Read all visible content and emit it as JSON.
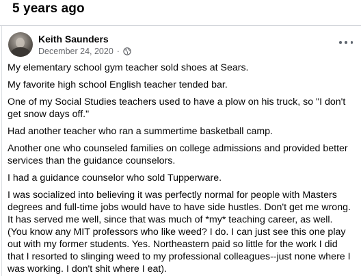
{
  "memory": {
    "title": "5 years ago"
  },
  "post": {
    "author": "Keith Saunders",
    "date": "December 24, 2020",
    "separator": "·",
    "privacy_icon": "globe-icon",
    "more_icon": "more-options-icon",
    "paragraphs": [
      "My elementary school gym teacher sold shoes at Sears.",
      "My favorite high school English teacher tended bar.",
      "One of my Social Studies teachers used to have a plow on his truck, so \"I don't get snow days off.\"",
      "Had another teacher who ran a summertime basketball camp.",
      "Another one who counseled families on college admissions and provided better services than the guidance counselors.",
      "I had a guidance counselor who sold Tupperware.",
      "I was socialized into believing it was perfectly normal for people with Masters degrees and full-time jobs would have to have side hustles.  Don't get me wrong. It has served me well, since that was much of *my* teaching career, as well. (You know any MIT professors who like weed? I do. I can just see this one play out with my former students.  Yes. Northeastern paid so little for the work I did that I resorted to slinging weed to my professional colleagues--just none where I was working. I don't shit where I eat)."
    ]
  }
}
